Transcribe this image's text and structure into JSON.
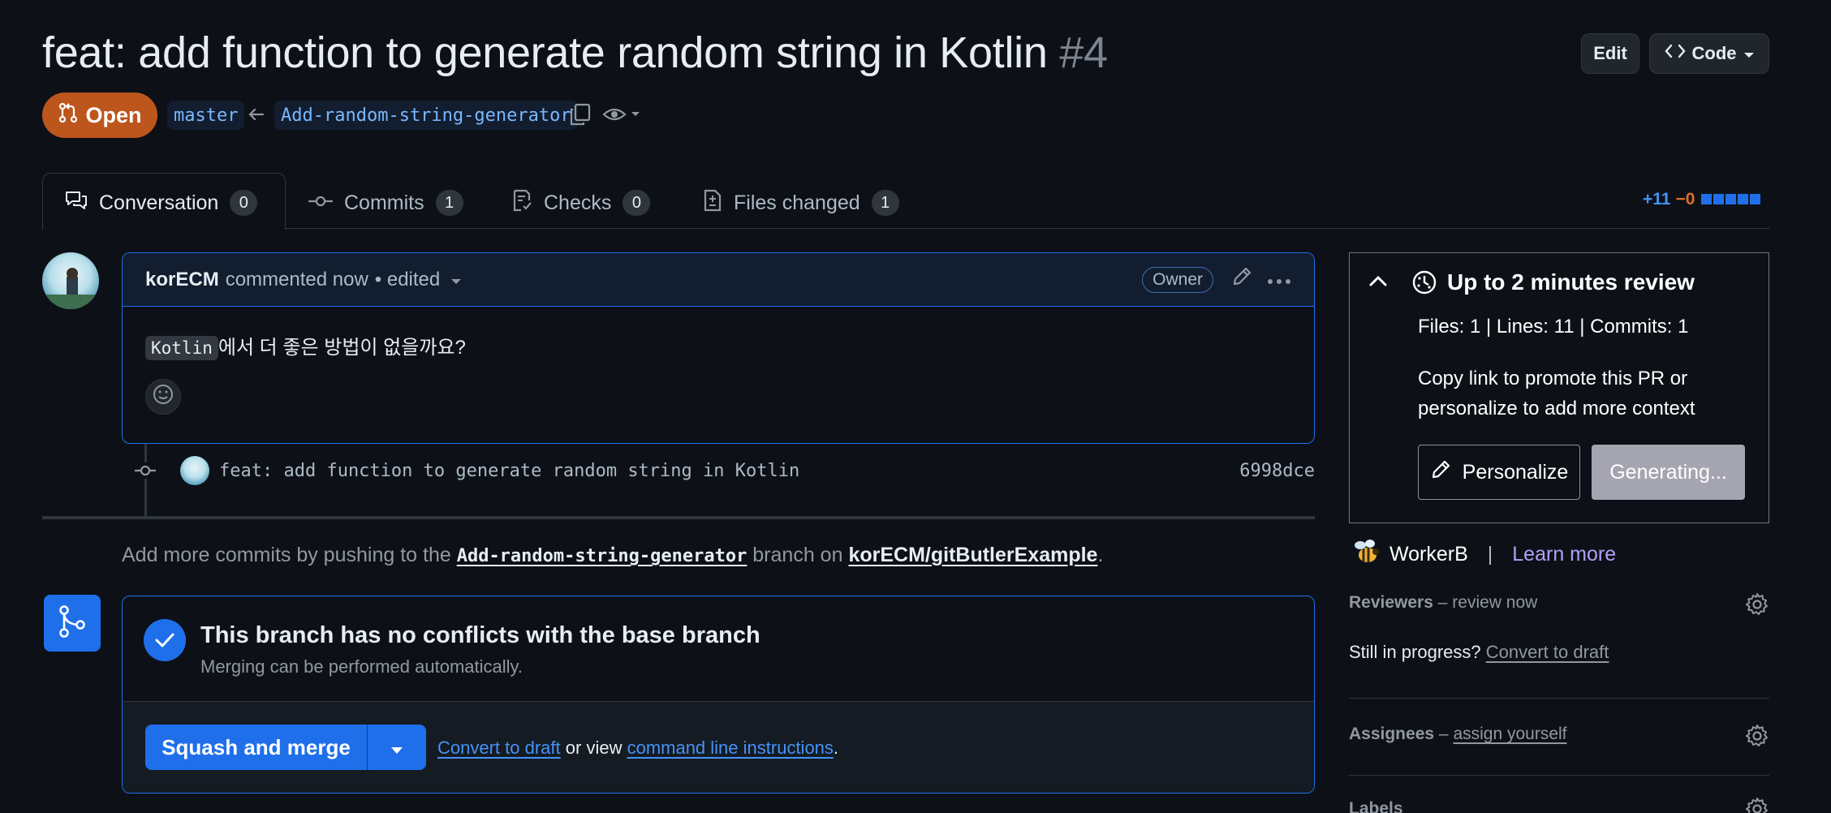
{
  "header": {
    "title": "feat: add function to generate random string in Kotlin",
    "number": "#4",
    "edit_label": "Edit",
    "code_label": "Code",
    "state_label": "Open",
    "base_branch": "master",
    "head_branch": "Add-random-string-generator"
  },
  "tabs": [
    {
      "label": "Conversation",
      "count": "0"
    },
    {
      "label": "Commits",
      "count": "1"
    },
    {
      "label": "Checks",
      "count": "0"
    },
    {
      "label": "Files changed",
      "count": "1"
    }
  ],
  "diffstat": {
    "additions": "+11",
    "deletions": "−0"
  },
  "comment": {
    "author": "korECM",
    "action": "commented now",
    "edited": "• edited",
    "badge": "Owner",
    "code": "Kotlin",
    "text": "에서 더 좋은 방법이 없을까요?"
  },
  "commit": {
    "message": "feat: add function to generate random string in Kotlin",
    "sha": "6998dce"
  },
  "push_note": {
    "prefix": "Add more commits by pushing to the",
    "branch": "Add-random-string-generator",
    "middle": "branch on",
    "repo": "korECM/gitButlerExample",
    "suffix": "."
  },
  "merge": {
    "title": "This branch has no conflicts with the base branch",
    "subtitle": "Merging can be performed automatically.",
    "button_label": "Squash and merge",
    "convert_link": "Convert to draft",
    "or_view": "or view",
    "cli_link": "command line instructions",
    "period": "."
  },
  "review_widget": {
    "title": "Up to 2 minutes review",
    "stats": "Files: 1 | Lines: 11 | Commits: 1",
    "promo_line1": "Copy link to promote this PR or",
    "promo_line2": "personalize to add more context",
    "personalize_label": "Personalize",
    "generating_label": "Generating..."
  },
  "workerb": {
    "name": "WorkerB",
    "separator": "|",
    "learn_more": "Learn more"
  },
  "sidebar": {
    "reviewers_label": "Reviewers",
    "reviewers_dash": "–",
    "reviewers_value": "review now",
    "in_progress": "Still in progress?",
    "convert_link": "Convert to draft",
    "assignees_label": "Assignees",
    "assignees_dash": "–",
    "assignees_value": "assign yourself",
    "labels_label": "Labels"
  },
  "colors": {
    "accent": "#1f6feb",
    "open_badge": "#bd561d",
    "background": "#0d1117"
  }
}
